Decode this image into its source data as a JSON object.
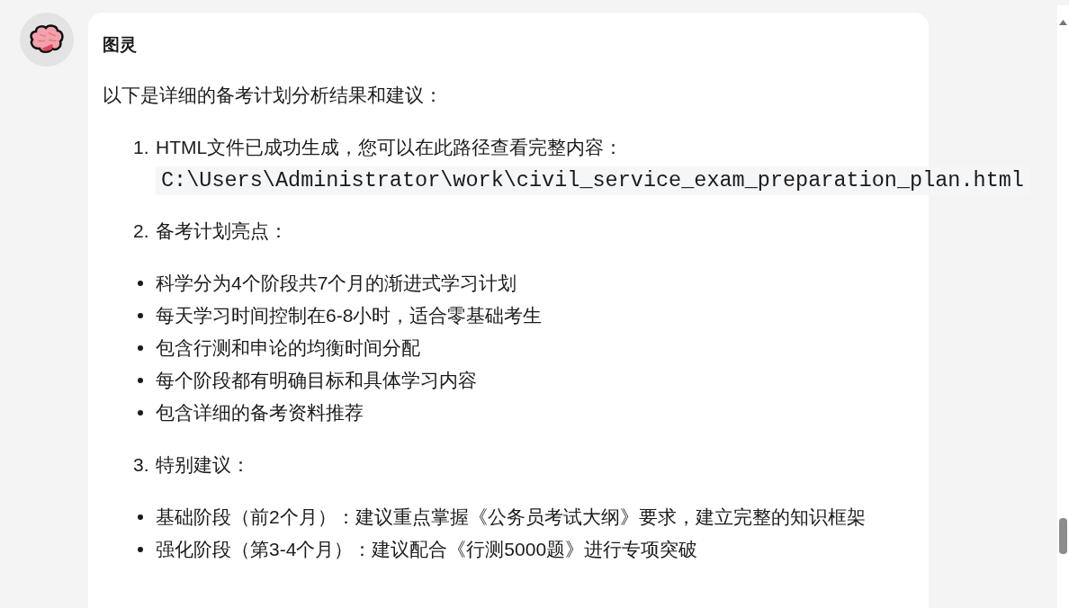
{
  "message": {
    "sender": "图灵",
    "intro": "以下是详细的备考计划分析结果和建议：",
    "sections": [
      {
        "number": "1.",
        "title": "HTML文件已成功生成，您可以在此路径查看完整内容：",
        "code": "C:\\Users\\Administrator\\work\\civil_service_exam_preparation_plan.html"
      },
      {
        "number": "2.",
        "title": "备考计划亮点：",
        "bullets": [
          "科学分为4个阶段共7个月的渐进式学习计划",
          "每天学习时间控制在6-8小时，适合零基础考生",
          "包含行测和申论的均衡时间分配",
          "每个阶段都有明确目标和具体学习内容",
          "包含详细的备考资料推荐"
        ]
      },
      {
        "number": "3.",
        "title": "特别建议：",
        "bullets": [
          "基础阶段（前2个月）：建议重点掌握《公务员考试大纲》要求，建立完整的知识框架",
          "强化阶段（第3-4个月）：建议配合《行测5000题》进行专项突破"
        ]
      }
    ]
  }
}
